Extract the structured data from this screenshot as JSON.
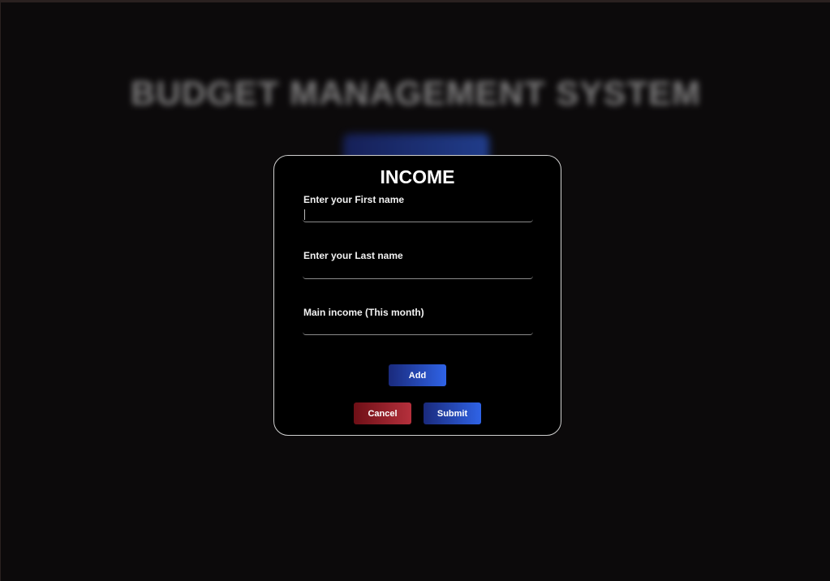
{
  "background": {
    "title": "BUDGET MANAGEMENT SYSTEM"
  },
  "modal": {
    "title": "INCOME",
    "fields": [
      {
        "label": "Enter your First name",
        "value": "",
        "placeholder": ""
      },
      {
        "label": "Enter your Last name",
        "value": "",
        "placeholder": ""
      },
      {
        "label": "Main income (This month)",
        "value": "",
        "placeholder": ""
      }
    ],
    "add_label": "Add",
    "cancel_label": "Cancel",
    "submit_label": "Submit"
  },
  "colors": {
    "background": "#0c0a0b",
    "modal_bg": "#000000",
    "accent_blue": "#2f63e6",
    "accent_red": "#b5303c"
  }
}
